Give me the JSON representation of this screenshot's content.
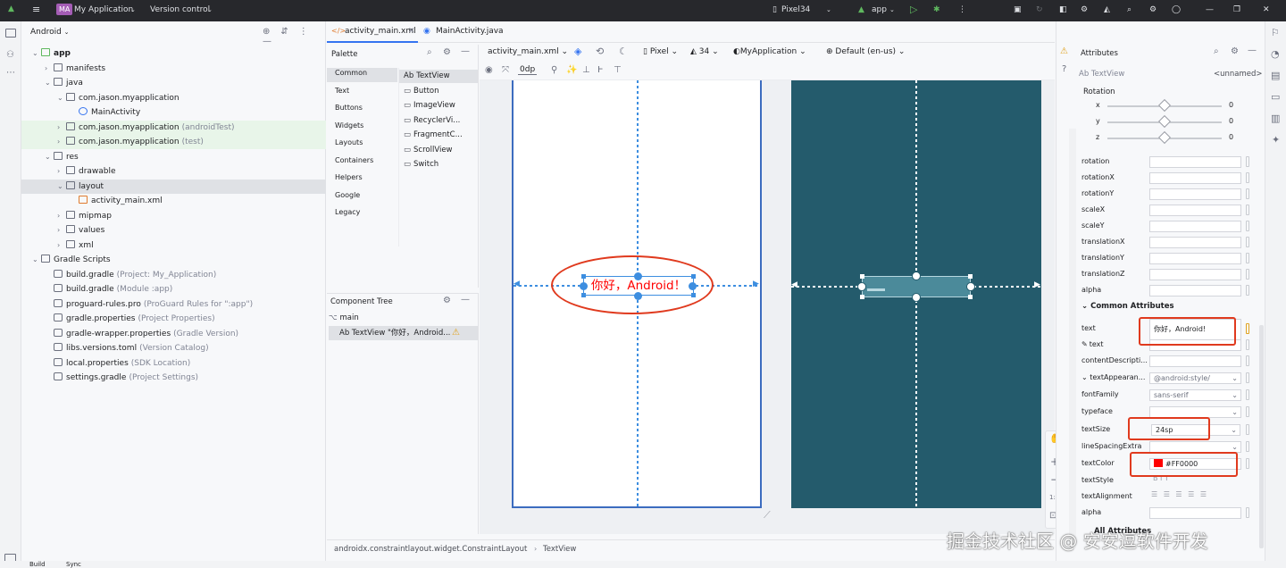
{
  "titlebar": {
    "project_badge": "MA",
    "project_name": "My Application",
    "vcs": "Version control",
    "device": "Pixel34",
    "run_config": "app"
  },
  "project_panel": {
    "view": "Android",
    "tree": [
      {
        "label": "app",
        "extra": "",
        "indent": 0,
        "bold": true
      },
      {
        "label": "manifests",
        "extra": "",
        "indent": 1
      },
      {
        "label": "java",
        "extra": "",
        "indent": 1
      },
      {
        "label": "com.jason.myapplication",
        "extra": "",
        "indent": 2
      },
      {
        "label": "MainActivity",
        "extra": "",
        "indent": 3
      },
      {
        "label": "com.jason.myapplication",
        "extra": "(androidTest)",
        "indent": 2
      },
      {
        "label": "com.jason.myapplication",
        "extra": "(test)",
        "indent": 2
      },
      {
        "label": "res",
        "extra": "",
        "indent": 1
      },
      {
        "label": "drawable",
        "extra": "",
        "indent": 2
      },
      {
        "label": "layout",
        "extra": "",
        "indent": 2
      },
      {
        "label": "activity_main.xml",
        "extra": "",
        "indent": 3
      },
      {
        "label": "mipmap",
        "extra": "",
        "indent": 2
      },
      {
        "label": "values",
        "extra": "",
        "indent": 2
      },
      {
        "label": "xml",
        "extra": "",
        "indent": 2
      },
      {
        "label": "Gradle Scripts",
        "extra": "",
        "indent": 0
      },
      {
        "label": "build.gradle",
        "extra": "(Project: My_Application)",
        "indent": 1
      },
      {
        "label": "build.gradle",
        "extra": "(Module :app)",
        "indent": 1
      },
      {
        "label": "proguard-rules.pro",
        "extra": "(ProGuard Rules for \":app\")",
        "indent": 1
      },
      {
        "label": "gradle.properties",
        "extra": "(Project Properties)",
        "indent": 1
      },
      {
        "label": "gradle-wrapper.properties",
        "extra": "(Gradle Version)",
        "indent": 1
      },
      {
        "label": "libs.versions.toml",
        "extra": "(Version Catalog)",
        "indent": 1
      },
      {
        "label": "local.properties",
        "extra": "(SDK Location)",
        "indent": 1
      },
      {
        "label": "settings.gradle",
        "extra": "(Project Settings)",
        "indent": 1
      }
    ]
  },
  "editor": {
    "tabs": [
      "activity_main.xml",
      "MainActivity.java"
    ],
    "palette_title": "Palette",
    "categories": [
      "Common",
      "Text",
      "Buttons",
      "Widgets",
      "Layouts",
      "Containers",
      "Helpers",
      "Google",
      "Legacy"
    ],
    "widgets": [
      {
        "prefix": "Ab",
        "label": "TextView"
      },
      {
        "prefix": "",
        "label": "Button"
      },
      {
        "prefix": "",
        "label": "ImageView"
      },
      {
        "prefix": "",
        "label": "RecyclerVi..."
      },
      {
        "prefix": "",
        "label": "FragmentC..."
      },
      {
        "prefix": "",
        "label": "ScrollView"
      },
      {
        "prefix": "",
        "label": "Switch"
      }
    ],
    "component_tree_title": "Component Tree",
    "component_root": "main",
    "component_child": "TextView \"你好，Android...",
    "toolbar": {
      "file": "activity_main.xml",
      "device": "Pixel",
      "api": "34",
      "theme": "MyApplication",
      "locale": "Default (en-us)",
      "margin": "0dp"
    },
    "preview_text": "你好，Android！",
    "breadcrumb": [
      "androidx.constraintlayout.widget.ConstraintLayout",
      "TextView"
    ]
  },
  "attributes": {
    "title": "Attributes",
    "widget_type": "Ab TextView",
    "widget_id": "<unnamed>",
    "rotation_title": "Rotation",
    "rotation": [
      {
        "axis": "x",
        "value": "0"
      },
      {
        "axis": "y",
        "value": "0"
      },
      {
        "axis": "z",
        "value": "0"
      }
    ],
    "transform_fields": [
      "rotation",
      "rotationX",
      "rotationY",
      "scaleX",
      "scaleY",
      "translationX",
      "translationY",
      "translationZ",
      "alpha"
    ],
    "common_title": "Common Attributes",
    "common": [
      {
        "name": "text",
        "value": "你好，Android!"
      },
      {
        "name": "text",
        "value": ""
      },
      {
        "name": "contentDescripti...",
        "value": ""
      },
      {
        "name": "textAppearan...",
        "value": "@android:style/"
      },
      {
        "name": "fontFamily",
        "value": "sans-serif"
      },
      {
        "name": "typeface",
        "value": ""
      },
      {
        "name": "textSize",
        "value": "24sp"
      },
      {
        "name": "lineSpacingExtra",
        "value": ""
      },
      {
        "name": "textColor",
        "value": "#FF0000"
      },
      {
        "name": "textStyle",
        "value": "B  I  T"
      },
      {
        "name": "textAlignment",
        "value": ""
      },
      {
        "name": "alpha",
        "value": ""
      }
    ],
    "all_attributes": "All Attributes",
    "text_color_swatch": "#ff0000"
  },
  "bottom": {
    "build": "Build",
    "sync": "Sync"
  },
  "watermark": "掘金技术社区 @ 安安逗软件开发",
  "colors": {
    "accent": "#3574f0",
    "annotation": "#e03a1e",
    "dark_preview": "#245b6c"
  }
}
